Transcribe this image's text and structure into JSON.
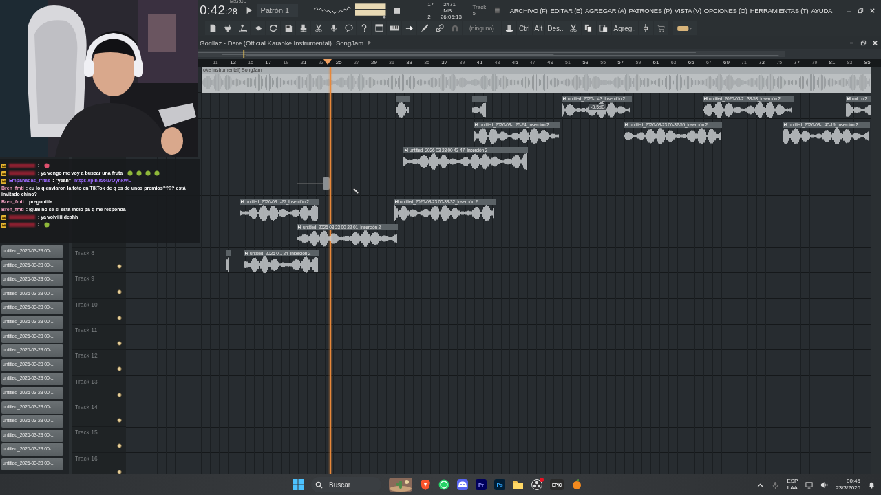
{
  "topbar": {
    "time_main": "0:42",
    "time_cs": ":28",
    "time_unit": "M:S:CS",
    "pattern": "Patrón 1",
    "add_pattern": "+",
    "cpu": "17",
    "memory": "2471 MB",
    "polyphony": "2",
    "clock": "26:06:13",
    "hint": "Track 5"
  },
  "menu": [
    "ARCHIVO (F)",
    "EDITAR (E)",
    "AGREGAR (A)",
    "PATRONES (P)",
    "VISTA (V)",
    "OPCIONES (O)",
    "HERRAMIENTAS (T)",
    "AYUDA"
  ],
  "toolbar": {
    "snap": "(ninguno)",
    "ctrl": "Ctrl",
    "alt": "Alt",
    "deselect": "Des..",
    "add": "Agreg.."
  },
  "playlist": {
    "title": "Gorillaz - Dare (Official Karaoke Instrumental)",
    "view": "SongJam"
  },
  "ruler": [
    "11",
    "13",
    "15",
    "17",
    "19",
    "21",
    "23",
    "25",
    "27",
    "29",
    "31",
    "33",
    "35",
    "37",
    "39",
    "41",
    "43",
    "45",
    "47",
    "49",
    "51",
    "53",
    "55",
    "57",
    "59",
    "61",
    "63",
    "65",
    "67",
    "69",
    "71",
    "73",
    "75",
    "77",
    "79",
    "81",
    "83",
    "85"
  ],
  "audio_track": {
    "name": "oke Instrumental)  SongJam"
  },
  "clips": [
    {
      "kind": "stub"
    },
    {
      "kind": "stub"
    },
    {
      "kind": "named",
      "name": "untitled_2026-...43_Inserción 2",
      "tooltip": "-3.5dB"
    },
    {
      "kind": "named",
      "name": "untitled_2026-03-2...38-53_Inserción 2"
    },
    {
      "kind": "named",
      "name": "unt...n 2"
    },
    {
      "kind": "named",
      "name": "untitled_2026-03-...25-24_Inserción 2"
    },
    {
      "kind": "named",
      "name": "untitled_2026-03-23 00-32-55_Inserción 2"
    },
    {
      "kind": "named",
      "name": "untitled_2026-03-...40-19_Inserción 2"
    },
    {
      "kind": "named",
      "name": "untitled_2026-03-23 00-43-47_Inserción 2"
    },
    {
      "kind": "fragment"
    },
    {
      "kind": "named",
      "name": "untitled_2026-03...-27_Inserción 2"
    },
    {
      "kind": "named",
      "name": "untitled_2026-03-23 00-38-32_Inserción 2"
    },
    {
      "kind": "named",
      "name": "untitled_2026-03-23 00-22-01_Inserción 2"
    },
    {
      "kind": "stub"
    },
    {
      "kind": "named",
      "name": "untitled_2026-0...-24_Inserción 2"
    }
  ],
  "tracks": [
    {
      "label": "Track 8"
    },
    {
      "label": "Track 9"
    },
    {
      "label": "Track 10"
    },
    {
      "label": "Track 11"
    },
    {
      "label": "Track 12"
    },
    {
      "label": "Track 13"
    },
    {
      "label": "Track 14"
    },
    {
      "label": "Track 15"
    },
    {
      "label": "Track 16"
    }
  ],
  "browser": [
    "untitled_2026-03-23 00-...",
    "untitled_2026-03-23 00-...",
    "untitled_2026-03-23 00-...",
    "untitled_2026-03-23 00-...",
    "untitled_2026-03-23 00-...",
    "untitled_2026-03-23 00-...",
    "untitled_2026-03-23 00-...",
    "untitled_2026-03-23 00-...",
    "untitled_2026-03-23 00-...",
    "untitled_2026-03-23 00-...",
    "untitled_2026-03-23 00-...",
    "untitled_2026-03-23 00-...",
    "untitled_2026-03-23 00-...",
    "untitled_2026-03-23 00-...",
    "untitled_2026-03-23 00-...",
    "untitled_2026-03-23 00-..."
  ],
  "chat": [
    {
      "badge": true,
      "redacted": true,
      "text": ":",
      "emotes": [
        {
          "color": "#e0506e"
        }
      ]
    },
    {
      "badge": true,
      "redacted": true,
      "text": ": ya vengo me voy a buscar una fruta",
      "emotes": [
        {
          "color": "#8fb83a"
        },
        {
          "color": "#8fb83a"
        },
        {
          "color": "#8fb83a"
        },
        {
          "color": "#8fb83a"
        }
      ]
    },
    {
      "badge": true,
      "redacted": false,
      "user": "Empanadas_fritas",
      "color": "#9d6bff",
      "text": ": \"yeah\"",
      "link": "https://pin.it/6u7OynkWL"
    },
    {
      "badge": false,
      "redacted": false,
      "user": "Bren_fmti",
      "color": "#f0a0c0",
      "text": ": eu lo q enviaron la foto en TikTok de q es de unos premios???? está invitado chino?"
    },
    {
      "badge": false,
      "redacted": false,
      "user": "Bren_fmti",
      "color": "#f0a0c0",
      "text": ": preguntita"
    },
    {
      "badge": false,
      "redacted": false,
      "user": "Bren_fmti",
      "color": "#f0a0c0",
      "text": ": igual no sé si está indio pa q me responda"
    },
    {
      "badge": true,
      "redacted": true,
      "text": ": ya volviiii deahh"
    },
    {
      "badge": true,
      "redacted": true,
      "text": ":",
      "emotes": [
        {
          "color": "#8fb83a"
        }
      ]
    }
  ],
  "taskbar": {
    "search": "Buscar",
    "apps": [
      "Pr",
      "Ps",
      "EPIC"
    ],
    "language": "ESP",
    "layout": "LAA",
    "time": "00:45",
    "date": "23/3/2026"
  }
}
